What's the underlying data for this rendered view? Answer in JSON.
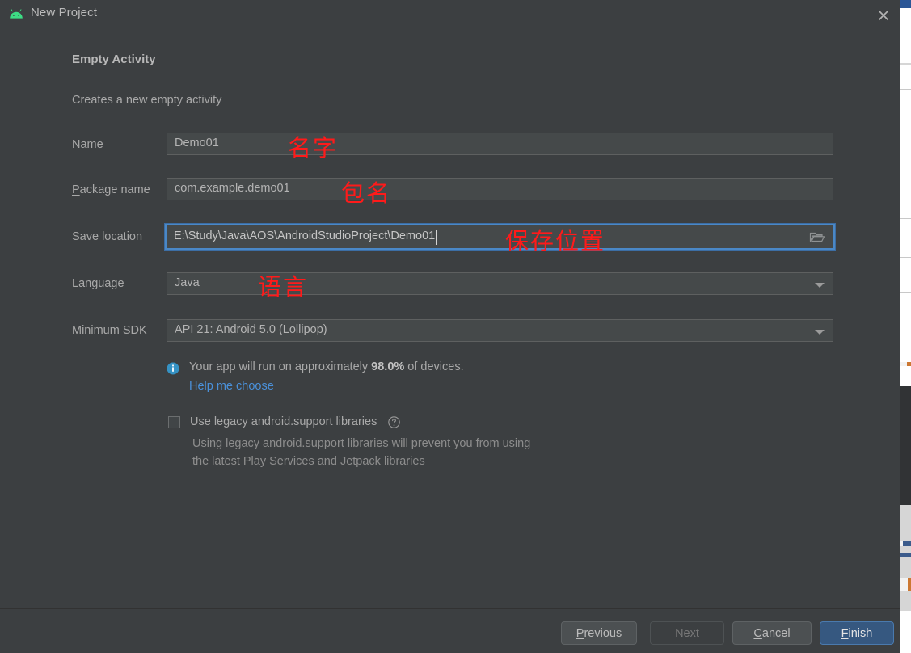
{
  "window": {
    "title": "New Project",
    "icon": "android-logo-icon",
    "close_icon": "close-icon"
  },
  "content": {
    "heading": "Empty Activity",
    "subheading": "Creates a new empty activity"
  },
  "fields": [
    {
      "key": "name",
      "label_prefix": "",
      "label_mnemonic": "N",
      "label_suffix": "ame",
      "value": "Demo01",
      "annotation": "名字"
    },
    {
      "key": "package_name",
      "label_prefix": "",
      "label_mnemonic": "P",
      "label_suffix": "ackage name",
      "value": "com.example.demo01",
      "annotation": "包名"
    },
    {
      "key": "save_location",
      "label_prefix": "",
      "label_mnemonic": "S",
      "label_suffix": "ave location",
      "value": "E:\\Study\\Java\\AOS\\AndroidStudioProject\\Demo01",
      "annotation": "保存位置",
      "browse_icon": "folder-icon"
    },
    {
      "key": "language",
      "label_prefix": "",
      "label_mnemonic": "L",
      "label_suffix": "anguage",
      "value": "Java",
      "annotation": "语言",
      "dropdown_icon": "chevron-down-icon"
    },
    {
      "key": "minimum_sdk",
      "label_prefix": "Minimum SDK",
      "label_mnemonic": "",
      "label_suffix": "",
      "value": "API 21: Android 5.0 (Lollipop)",
      "annotation": "",
      "dropdown_icon": "chevron-down-icon"
    }
  ],
  "info": {
    "icon": "info-icon",
    "text_before": "Your app will run on approximately ",
    "percent": "98.0%",
    "text_after": " of devices.",
    "link_label": "Help me choose"
  },
  "legacy": {
    "checkbox_checked": false,
    "label": "Use legacy android.support libraries",
    "help_icon": "question-mark-icon",
    "description_line1": "Using legacy android.support libraries will prevent you from using",
    "description_line2": "the latest Play Services and Jetpack libraries"
  },
  "footer": {
    "previous": {
      "prefix": "",
      "mnemonic": "P",
      "suffix": "revious"
    },
    "next": {
      "prefix": "Next",
      "mnemonic": "",
      "suffix": ""
    },
    "cancel": {
      "prefix": "",
      "mnemonic": "C",
      "suffix": "ancel"
    },
    "finish": {
      "prefix": "",
      "mnemonic": "F",
      "suffix": "inish"
    }
  },
  "colors": {
    "dialog_bg": "#3c3f41",
    "field_bg": "#45494a",
    "focus_border": "#4a88c7",
    "primary_button": "#365880",
    "link": "#4a90d9",
    "annotation_red": "#ff1a1a",
    "android_green": "#3ddc84"
  }
}
